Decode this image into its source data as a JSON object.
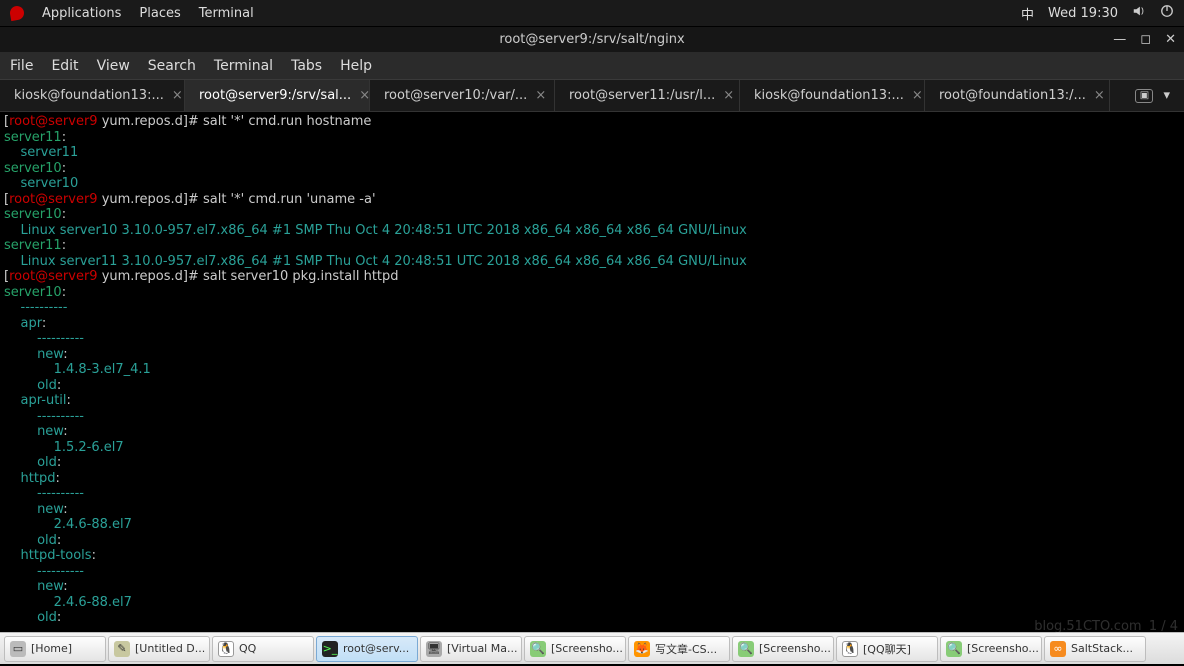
{
  "gnome": {
    "menus": [
      "Applications",
      "Places",
      "Terminal"
    ],
    "ime": "中",
    "clock": "Wed 19:30"
  },
  "window": {
    "title": "root@server9:/srv/salt/nginx"
  },
  "menubar": [
    "File",
    "Edit",
    "View",
    "Search",
    "Terminal",
    "Tabs",
    "Help"
  ],
  "tabs": [
    {
      "label": "kiosk@foundation13:...",
      "active": false
    },
    {
      "label": "root@server9:/srv/sal...",
      "active": true
    },
    {
      "label": "root@server10:/var/...",
      "active": false
    },
    {
      "label": "root@server11:/usr/l...",
      "active": false
    },
    {
      "label": "kiosk@foundation13:...",
      "active": false
    },
    {
      "label": "root@foundation13:/...",
      "active": false
    }
  ],
  "term": {
    "prompt_user": "root",
    "prompt_host": "server9",
    "prompt_cwd": "yum.repos.d",
    "lines": [
      {
        "t": "prompt",
        "cmd": "salt '*' cmd.run hostname"
      },
      {
        "t": "green",
        "text": "server11:"
      },
      {
        "t": "cyan",
        "indent": 4,
        "text": "server11"
      },
      {
        "t": "green",
        "text": "server10:"
      },
      {
        "t": "cyan",
        "indent": 4,
        "text": "server10"
      },
      {
        "t": "prompt",
        "cmd": "salt '*' cmd.run 'uname -a'"
      },
      {
        "t": "green",
        "text": "server10:"
      },
      {
        "t": "cyan",
        "indent": 4,
        "text": "Linux server10 3.10.0-957.el7.x86_64 #1 SMP Thu Oct 4 20:48:51 UTC 2018 x86_64 x86_64 x86_64 GNU/Linux"
      },
      {
        "t": "green",
        "text": "server11:"
      },
      {
        "t": "cyan",
        "indent": 4,
        "text": "Linux server11 3.10.0-957.el7.x86_64 #1 SMP Thu Oct 4 20:48:51 UTC 2018 x86_64 x86_64 x86_64 GNU/Linux"
      },
      {
        "t": "prompt",
        "cmd": "salt server10 pkg.install httpd"
      },
      {
        "t": "green",
        "text": "server10:"
      },
      {
        "t": "cyan",
        "indent": 4,
        "text": "----------"
      },
      {
        "t": "cyan",
        "indent": 4,
        "text": "apr:"
      },
      {
        "t": "cyan",
        "indent": 8,
        "text": "----------"
      },
      {
        "t": "cyan",
        "indent": 8,
        "text": "new:"
      },
      {
        "t": "cyan",
        "indent": 12,
        "text": "1.4.8-3.el7_4.1"
      },
      {
        "t": "cyan",
        "indent": 8,
        "text": "old:"
      },
      {
        "t": "cyan",
        "indent": 4,
        "text": "apr-util:"
      },
      {
        "t": "cyan",
        "indent": 8,
        "text": "----------"
      },
      {
        "t": "cyan",
        "indent": 8,
        "text": "new:"
      },
      {
        "t": "cyan",
        "indent": 12,
        "text": "1.5.2-6.el7"
      },
      {
        "t": "cyan",
        "indent": 8,
        "text": "old:"
      },
      {
        "t": "cyan",
        "indent": 4,
        "text": "httpd:"
      },
      {
        "t": "cyan",
        "indent": 8,
        "text": "----------"
      },
      {
        "t": "cyan",
        "indent": 8,
        "text": "new:"
      },
      {
        "t": "cyan",
        "indent": 12,
        "text": "2.4.6-88.el7"
      },
      {
        "t": "cyan",
        "indent": 8,
        "text": "old:"
      },
      {
        "t": "cyan",
        "indent": 4,
        "text": "httpd-tools:"
      },
      {
        "t": "cyan",
        "indent": 8,
        "text": "----------"
      },
      {
        "t": "cyan",
        "indent": 8,
        "text": "new:"
      },
      {
        "t": "cyan",
        "indent": 12,
        "text": "2.4.6-88.el7"
      },
      {
        "t": "cyan",
        "indent": 8,
        "text": "old:"
      }
    ]
  },
  "watermark": "blog.51CTO.com",
  "watermark_page": "1 / 4",
  "taskbar": [
    {
      "icon": "folder",
      "label": "[Home]"
    },
    {
      "icon": "edit",
      "label": "[Untitled D..."
    },
    {
      "icon": "qq",
      "label": "QQ"
    },
    {
      "icon": "term",
      "label": "root@serv...",
      "active": true
    },
    {
      "icon": "vm",
      "label": "[Virtual Ma..."
    },
    {
      "icon": "shot",
      "label": "[Screensho..."
    },
    {
      "icon": "ff",
      "label": "写文章-CS..."
    },
    {
      "icon": "shot",
      "label": "[Screensho..."
    },
    {
      "icon": "qqchat",
      "label": "[QQ聊天]"
    },
    {
      "icon": "shot",
      "label": "[Screensho..."
    },
    {
      "icon": "salt",
      "label": "SaltStack..."
    }
  ]
}
